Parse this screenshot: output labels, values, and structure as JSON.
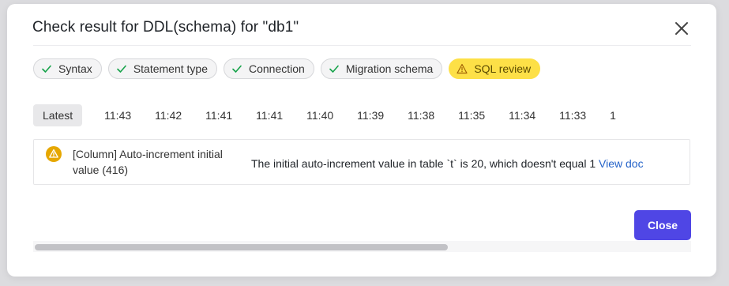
{
  "dialog": {
    "title": "Check result for DDL(schema) for \"db1\""
  },
  "checks": [
    {
      "label": "Syntax",
      "status": "success"
    },
    {
      "label": "Statement type",
      "status": "success"
    },
    {
      "label": "Connection",
      "status": "success"
    },
    {
      "label": "Migration schema",
      "status": "success"
    },
    {
      "label": "SQL review",
      "status": "warning"
    }
  ],
  "history_tabs": {
    "latest": "Latest",
    "times": [
      "11:43",
      "11:42",
      "11:41",
      "11:41",
      "11:40",
      "11:39",
      "11:38",
      "11:35",
      "11:34",
      "11:33",
      "1"
    ]
  },
  "result": {
    "title": "[Column] Auto-increment initial value (416)",
    "message": "The initial auto-increment value in table `t` is 20, which doesn't equal 1",
    "link": "View doc"
  },
  "footer": {
    "close_label": "Close"
  },
  "colors": {
    "accent": "#4f46e5",
    "success": "#16a34a",
    "warning": "#fde047",
    "warning_icon": "#e6a700",
    "link": "#2563c9"
  }
}
